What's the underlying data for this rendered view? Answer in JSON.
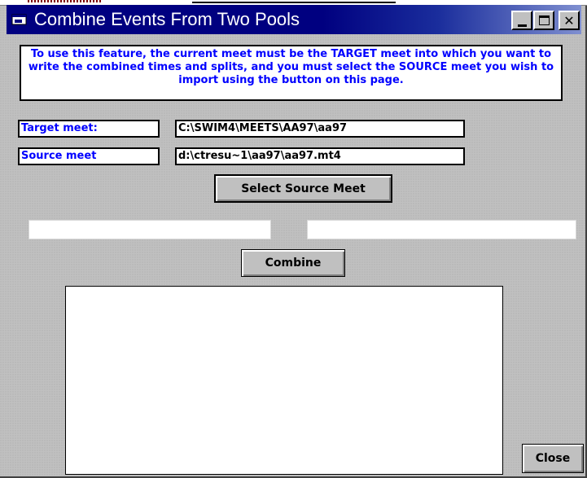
{
  "window": {
    "title": "Combine Events From Two Pools",
    "buttons": {
      "minimize": "minimize-icon",
      "maximize": "maximize-icon",
      "close": "close-icon",
      "close_glyph": "✕"
    }
  },
  "info": {
    "text": "To use this feature, the current meet must be the TARGET meet into which you want to write the combined times and splits, and you must select the SOURCE meet you wish to import using the button on this page."
  },
  "target": {
    "label": "Target meet:",
    "value": "C:\\SWIM4\\MEETS\\AA97\\aa97"
  },
  "source": {
    "label": "Source meet",
    "value": "d:\\ctresu~1\\aa97\\aa97.mt4"
  },
  "buttons": {
    "select_source": "Select Source Meet",
    "combine": "Combine",
    "close": "Close"
  },
  "status": {
    "left": "",
    "right": ""
  },
  "log": {
    "text": ""
  },
  "colors": {
    "title_bar": "#000080",
    "label_text": "#0000ff",
    "face": "#c0c0c0"
  }
}
